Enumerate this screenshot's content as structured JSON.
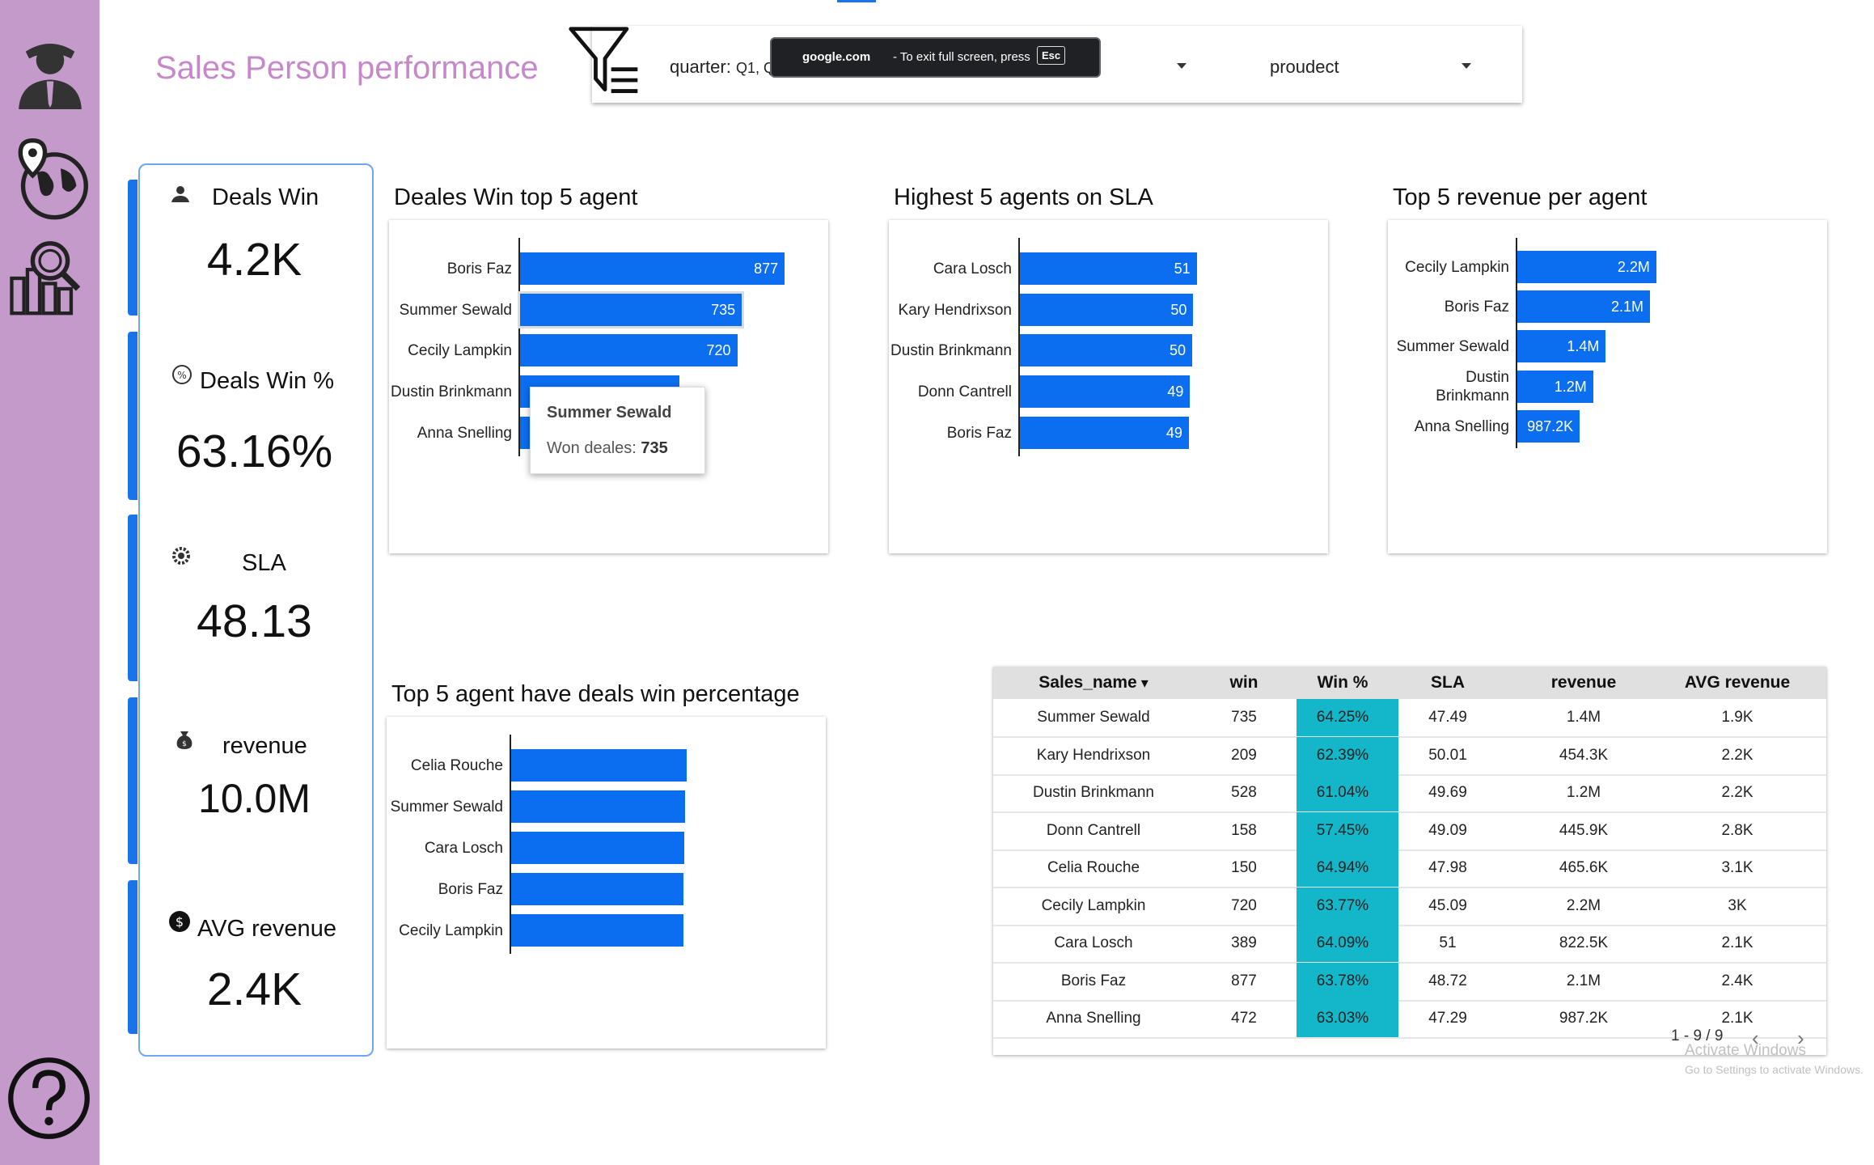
{
  "header": {
    "title": "Sales Person performance",
    "filters": [
      {
        "label": "quarter",
        "value": "Q1, Q"
      },
      {
        "label": "proudect",
        "value": ""
      }
    ]
  },
  "toast": {
    "domain": "google.com",
    "message": "-  To exit full screen, press",
    "key": "Esc"
  },
  "sidebar": {
    "items": [
      {
        "icon": "sales-person-icon"
      },
      {
        "icon": "globe-location-icon"
      },
      {
        "icon": "analytics-search-icon"
      }
    ],
    "help_icon": "help-icon"
  },
  "kpis": [
    {
      "label": "Deals Win",
      "value": "4.2K",
      "icon": "deals-icon"
    },
    {
      "label": "Deals Win %",
      "value": "63.16%",
      "icon": "percent-icon"
    },
    {
      "label": "SLA",
      "value": "48.13",
      "icon": "gear-icon"
    },
    {
      "label": "revenue",
      "value": "10.0M",
      "icon": "money-bag-icon"
    },
    {
      "label": "AVG revenue",
      "value": "2.4K",
      "icon": "dollar-coin-icon"
    }
  ],
  "tooltip": {
    "name": "Summer Sewald",
    "metric": "Won deales:",
    "value": "735"
  },
  "chart_data": [
    {
      "type": "bar",
      "orientation": "horizontal",
      "title": "Deales Win top 5 agent",
      "categories": [
        "Boris Faz",
        "Summer Sewald",
        "Cecily Lampkin",
        "Dustin Brinkmann",
        "Anna Snelling"
      ],
      "values": [
        877,
        735,
        720,
        528,
        472
      ],
      "labels": [
        "877",
        "735",
        "720",
        "",
        "472"
      ],
      "xlim": [
        0,
        1000
      ]
    },
    {
      "type": "bar",
      "orientation": "horizontal",
      "title": "Highest 5 agents on SLA",
      "categories": [
        "Cara Losch",
        "Kary Hendrixson",
        "Dustin Brinkmann",
        "Donn Cantrell",
        "Boris Faz"
      ],
      "values": [
        51,
        50.01,
        49.69,
        49.09,
        48.72
      ],
      "labels": [
        "51",
        "50",
        "50",
        "49",
        "49"
      ],
      "xlim": [
        0,
        100
      ]
    },
    {
      "type": "bar",
      "orientation": "horizontal",
      "title": "Top 5 revenue per agent",
      "categories": [
        "Cecily Lampkin",
        "Boris Faz",
        "Summer Sewald",
        "Dustin Brinkmann",
        "Anna Snelling"
      ],
      "values": [
        2200000,
        2100000,
        1400000,
        1200000,
        987200
      ],
      "labels": [
        "2.2M",
        "2.1M",
        "1.4M",
        "1.2M",
        "987.2K"
      ],
      "xlim": [
        0,
        5000000
      ]
    },
    {
      "type": "bar",
      "orientation": "horizontal",
      "title": "Top 5 agent have deals win percentage",
      "categories": [
        "Celia Rouche",
        "Summer Sewald",
        "Cara Losch",
        "Boris Faz",
        "Cecily Lampkin"
      ],
      "values": [
        64.94,
        64.25,
        64.09,
        63.78,
        63.77
      ],
      "labels": [
        "",
        "",
        "",
        "",
        ""
      ],
      "xlim": [
        0,
        100
      ]
    }
  ],
  "table": {
    "columns": [
      "Sales_name",
      "win",
      "Win %",
      "SLA",
      "revenue",
      "AVG revenue"
    ],
    "sort_column": "Sales_name",
    "rows": [
      [
        "Summer Sewald",
        "735",
        "64.25%",
        "47.49",
        "1.4M",
        "1.9K"
      ],
      [
        "Kary Hendrixson",
        "209",
        "62.39%",
        "50.01",
        "454.3K",
        "2.2K"
      ],
      [
        "Dustin Brinkmann",
        "528",
        "61.04%",
        "49.69",
        "1.2M",
        "2.2K"
      ],
      [
        "Donn Cantrell",
        "158",
        "57.45%",
        "49.09",
        "445.9K",
        "2.8K"
      ],
      [
        "Celia Rouche",
        "150",
        "64.94%",
        "47.98",
        "465.6K",
        "3.1K"
      ],
      [
        "Cecily Lampkin",
        "720",
        "63.77%",
        "45.09",
        "2.2M",
        "3K"
      ],
      [
        "Cara Losch",
        "389",
        "64.09%",
        "51",
        "822.5K",
        "2.1K"
      ],
      [
        "Boris Faz",
        "877",
        "63.78%",
        "48.72",
        "2.1M",
        "2.4K"
      ],
      [
        "Anna Snelling",
        "472",
        "63.03%",
        "47.29",
        "987.2K",
        "2.1K"
      ]
    ],
    "pager": "1 - 9 / 9"
  },
  "watermark": {
    "line1": "Activate Windows",
    "line2": "Go to Settings to activate Windows."
  },
  "colors": {
    "sidebar": "#c39ac9",
    "title": "#c588c8",
    "bar": "#0b6ef0",
    "win_cell": "#13b7c9",
    "kpi_accent": "#1a73e8"
  }
}
